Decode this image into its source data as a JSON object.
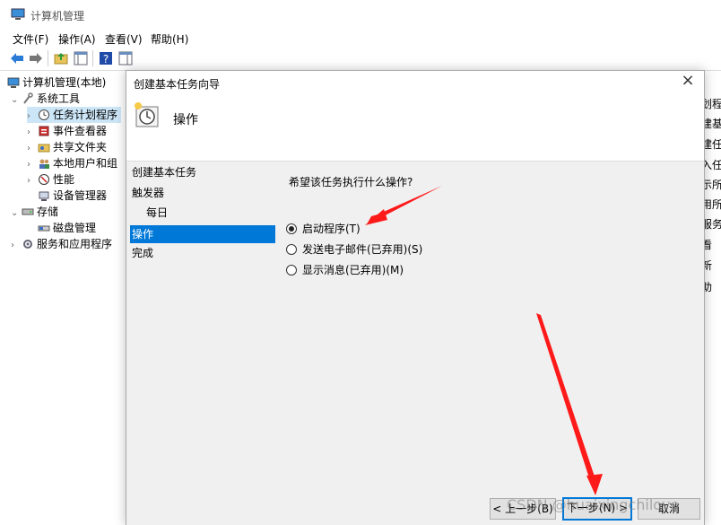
{
  "window": {
    "title": "计算机管理",
    "title_overflow": "计算机管理"
  },
  "menu": [
    "文件(F)",
    "操作(A)",
    "查看(V)",
    "帮助(H)"
  ],
  "tree": [
    {
      "label": "计算机管理(本地)",
      "arrow": "",
      "icon": "computer-icon"
    },
    {
      "label": "系统工具",
      "arrow": "⌄",
      "icon": "tools-icon"
    },
    {
      "label": "任务计划程序",
      "arrow": "›",
      "icon": "clock-icon",
      "selected": true
    },
    {
      "label": "事件查看器",
      "arrow": "›",
      "icon": "event-viewer-icon"
    },
    {
      "label": "共享文件夹",
      "arrow": "›",
      "icon": "shared-folder-icon"
    },
    {
      "label": "本地用户和组",
      "arrow": "›",
      "icon": "users-icon"
    },
    {
      "label": "性能",
      "arrow": "›",
      "icon": "performance-icon"
    },
    {
      "label": "设备管理器",
      "arrow": "",
      "icon": "device-manager-icon"
    },
    {
      "label": "存储",
      "arrow": "⌄",
      "icon": "storage-icon"
    },
    {
      "label": "磁盘管理",
      "arrow": "",
      "icon": "disk-icon"
    },
    {
      "label": "服务和应用程序",
      "arrow": "›",
      "icon": "services-icon"
    }
  ],
  "actions_panel": [
    "划程",
    "建基",
    "建任",
    "入任",
    "示所",
    "用所",
    "服务",
    "看",
    "新",
    "助"
  ],
  "wizard": {
    "title": "创建基本任务向导",
    "close": "×",
    "header_title": "操作",
    "steps": [
      {
        "label": "创建基本任务",
        "indent": false,
        "active": false
      },
      {
        "label": "触发器",
        "indent": false,
        "active": false
      },
      {
        "label": "每日",
        "indent": true,
        "active": false
      },
      {
        "label": "操作",
        "indent": false,
        "active": true
      },
      {
        "label": "完成",
        "indent": false,
        "active": false
      }
    ],
    "question": "希望该任务执行什么操作?",
    "options": [
      {
        "label": "启动程序(T)",
        "checked": true
      },
      {
        "label": "发送电子邮件(已弃用)(S)",
        "checked": false
      },
      {
        "label": "显示消息(已弃用)(M)",
        "checked": false
      }
    ],
    "buttons": {
      "back": "< 上一步(B)",
      "next": "下一步(N) >",
      "cancel": "取消"
    }
  },
  "watermark": "CSDN @huaixingchilove",
  "colors": {
    "selection": "#0078d7",
    "arrow": "#ff1a1a"
  }
}
